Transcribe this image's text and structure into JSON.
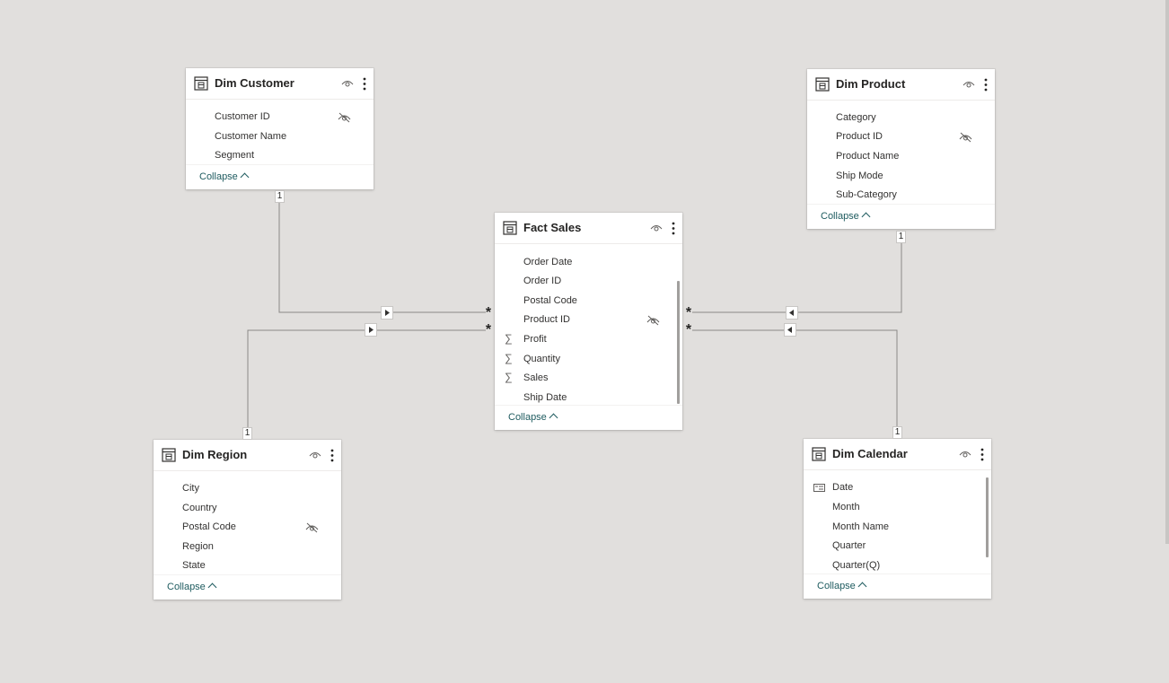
{
  "tables": {
    "dim_customer": {
      "title": "Dim Customer",
      "fields": [
        "Customer ID",
        "Customer Name",
        "Segment"
      ],
      "collapse": "Collapse"
    },
    "dim_product": {
      "title": "Dim Product",
      "fields": [
        "Category",
        "Product ID",
        "Product Name",
        "Ship Mode",
        "Sub-Category"
      ],
      "collapse": "Collapse"
    },
    "fact_sales": {
      "title": "Fact Sales",
      "fields": [
        "Order Date",
        "Order ID",
        "Postal Code",
        "Product ID",
        "Profit",
        "Quantity",
        "Sales",
        "Ship Date"
      ],
      "collapse": "Collapse"
    },
    "dim_region": {
      "title": "Dim Region",
      "fields": [
        "City",
        "Country",
        "Postal Code",
        "Region",
        "State"
      ],
      "collapse": "Collapse"
    },
    "dim_calendar": {
      "title": "Dim Calendar",
      "fields": [
        "Date",
        "Month",
        "Month Name",
        "Quarter",
        "Quarter(Q)"
      ],
      "collapse": "Collapse"
    }
  },
  "relationships": {
    "one_label": "1",
    "many_label": "*"
  },
  "icons": {
    "table": "table-icon",
    "visibility": "eye-icon",
    "hidden": "eye-hidden-icon",
    "more": "more-options-icon",
    "sum": "sigma-icon",
    "date": "calendar-field-icon"
  },
  "colors": {
    "canvas": "#e1dfdd",
    "link": "#1e5b5f",
    "line": "#8a8886"
  }
}
